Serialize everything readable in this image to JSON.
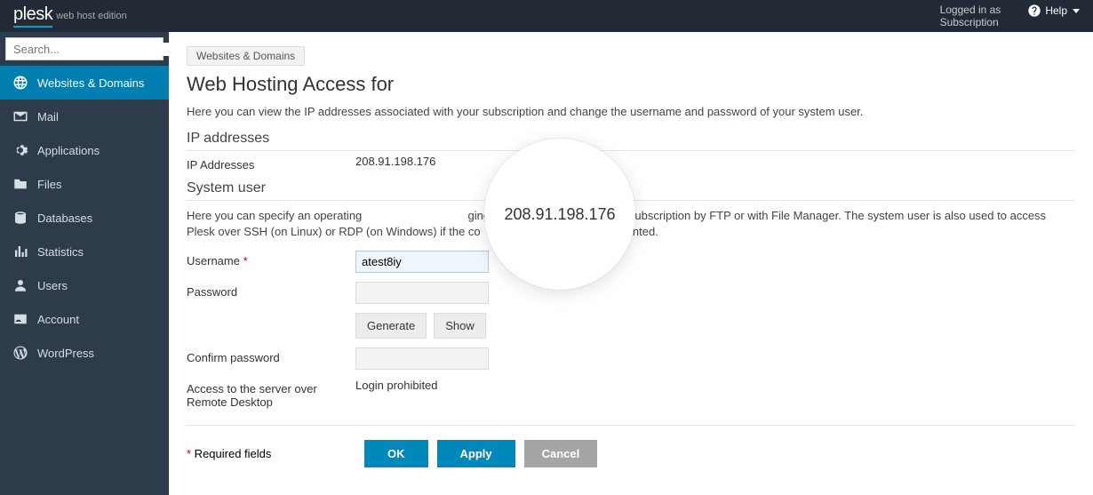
{
  "topbar": {
    "brand": "plesk",
    "brand_sub": "web host edition",
    "user_line1": "Logged in as",
    "user_line2": "Subscription",
    "help": "Help"
  },
  "search": {
    "placeholder": "Search..."
  },
  "sidebar": {
    "items": [
      {
        "label": "Websites & Domains",
        "icon": "globe",
        "active": true
      },
      {
        "label": "Mail",
        "icon": "mail",
        "active": false
      },
      {
        "label": "Applications",
        "icon": "gear",
        "active": false
      },
      {
        "label": "Files",
        "icon": "folder",
        "active": false
      },
      {
        "label": "Databases",
        "icon": "database",
        "active": false
      },
      {
        "label": "Statistics",
        "icon": "stats",
        "active": false
      },
      {
        "label": "Users",
        "icon": "user",
        "active": false
      },
      {
        "label": "Account",
        "icon": "id",
        "active": false
      },
      {
        "label": "WordPress",
        "icon": "wordpress",
        "active": false
      }
    ]
  },
  "breadcrumb": "Websites & Domains",
  "page_title": "Web Hosting Access for",
  "intro": "Here you can view the IP addresses associated with your subscription and change the username and password of your system user.",
  "sections": {
    "ip": {
      "heading": "IP addresses",
      "row_label": "IP Addresses",
      "value": "208.91.198.176"
    },
    "sysuser": {
      "heading": "System user",
      "desc_a": "Here you can specify an operating",
      "desc_b": "ging files and folders within the subscription by FTP or with File Manager. The system user is also used to access Plesk over SSH (on Linux) or RDP (on Windows) if the co",
      "desc_c": "missions are granted.",
      "username_label": "Username",
      "username_value": "atest8iy",
      "password_label": "Password",
      "generate": "Generate",
      "show": "Show",
      "confirm_label": "Confirm password",
      "access_label": "Access to the server over Remote Desktop",
      "access_value": "Login prohibited"
    }
  },
  "required_note_prefix": "*",
  "required_note": " Required fields",
  "actions": {
    "ok": "OK",
    "apply": "Apply",
    "cancel": "Cancel"
  },
  "magnifier_value": "208.91.198.176"
}
